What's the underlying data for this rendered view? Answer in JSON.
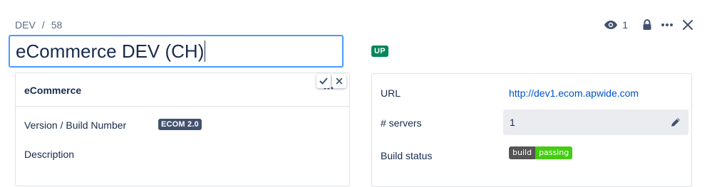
{
  "breadcrumb": {
    "project": "DEV",
    "separator": "/",
    "issue": "58"
  },
  "actions": {
    "watch_count": "1",
    "icons": [
      "eye-icon",
      "lock-icon",
      "more-icon",
      "close-icon"
    ]
  },
  "title": {
    "value": "eCommerce DEV (CH)"
  },
  "status": {
    "label": "UP",
    "color": "#00875a"
  },
  "left_panel": {
    "header": "eCommerce",
    "fields": [
      {
        "label": "Version / Build Number",
        "value": "ECOM 2.0"
      },
      {
        "label": "Description",
        "value": ""
      }
    ]
  },
  "right_panel": {
    "url": {
      "label": "URL",
      "value": "http://dev1.ecom.apwide.com"
    },
    "servers": {
      "label": "# servers",
      "value": "1"
    },
    "build": {
      "label": "Build status",
      "badge_left": "build",
      "badge_right": "passing",
      "badge_right_color": "#44cc11"
    }
  },
  "colors": {
    "accent": "#4c9aff",
    "link": "#0052cc",
    "text": "#172b4d"
  }
}
